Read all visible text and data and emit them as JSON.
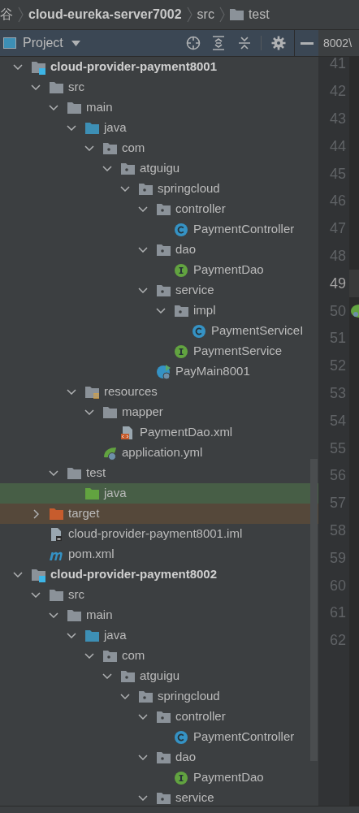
{
  "breadcrumb": [
    {
      "label": "谷",
      "kind": "text",
      "bold": false
    },
    {
      "label": "cloud-eureka-server7002",
      "kind": "text",
      "bold": true
    },
    {
      "label": "src",
      "kind": "text",
      "bold": false
    },
    {
      "label": "test",
      "kind": "folder",
      "bold": false
    }
  ],
  "project_panel": {
    "title": "Project",
    "tree": [
      {
        "label": "cloud-provider-payment8001",
        "kind": "module",
        "expanded": true,
        "selected": false,
        "children": [
          {
            "label": "src",
            "kind": "folder",
            "expanded": true,
            "selected": false,
            "children": [
              {
                "label": "main",
                "kind": "folder",
                "expanded": true,
                "selected": false,
                "children": [
                  {
                    "label": "java",
                    "kind": "source-folder",
                    "expanded": true,
                    "selected": false,
                    "children": [
                      {
                        "label": "com",
                        "kind": "package",
                        "expanded": true,
                        "selected": false,
                        "children": [
                          {
                            "label": "atguigu",
                            "kind": "package",
                            "expanded": true,
                            "selected": false,
                            "children": [
                              {
                                "label": "springcloud",
                                "kind": "package",
                                "expanded": true,
                                "selected": false,
                                "children": [
                                  {
                                    "label": "controller",
                                    "kind": "package",
                                    "expanded": true,
                                    "selected": false,
                                    "children": [
                                      {
                                        "label": "PaymentController",
                                        "kind": "class",
                                        "selected": false
                                      }
                                    ]
                                  },
                                  {
                                    "label": "dao",
                                    "kind": "package",
                                    "expanded": true,
                                    "selected": false,
                                    "children": [
                                      {
                                        "label": "PaymentDao",
                                        "kind": "interface",
                                        "selected": false
                                      }
                                    ]
                                  },
                                  {
                                    "label": "service",
                                    "kind": "package",
                                    "expanded": true,
                                    "selected": false,
                                    "children": [
                                      {
                                        "label": "impl",
                                        "kind": "package",
                                        "expanded": true,
                                        "selected": false,
                                        "children": [
                                          {
                                            "label": "PaymentServiceI",
                                            "kind": "class",
                                            "selected": false
                                          }
                                        ]
                                      },
                                      {
                                        "label": "PaymentService",
                                        "kind": "interface",
                                        "selected": false
                                      }
                                    ]
                                  },
                                  {
                                    "label": "PayMain8001",
                                    "kind": "boot-class",
                                    "selected": false
                                  }
                                ]
                              }
                            ]
                          }
                        ]
                      }
                    ]
                  },
                  {
                    "label": "resources",
                    "kind": "resources-folder",
                    "expanded": true,
                    "selected": false,
                    "children": [
                      {
                        "label": "mapper",
                        "kind": "folder",
                        "expanded": true,
                        "selected": false,
                        "children": [
                          {
                            "label": "PaymentDao.xml",
                            "kind": "xml",
                            "selected": false
                          }
                        ]
                      },
                      {
                        "label": "application.yml",
                        "kind": "yml",
                        "selected": false
                      }
                    ]
                  }
                ]
              },
              {
                "label": "test",
                "kind": "folder",
                "expanded": true,
                "selected": false,
                "children": [
                  {
                    "label": "java",
                    "kind": "test-folder",
                    "selected": true
                  }
                ]
              }
            ]
          },
          {
            "label": "target",
            "kind": "excluded-folder",
            "expanded": false,
            "selected": false
          },
          {
            "label": "cloud-provider-payment8001.iml",
            "kind": "iml",
            "selected": false
          },
          {
            "label": "pom.xml",
            "kind": "maven",
            "selected": false
          }
        ]
      },
      {
        "label": "cloud-provider-payment8002",
        "kind": "module",
        "expanded": true,
        "selected": false,
        "children": [
          {
            "label": "src",
            "kind": "folder",
            "expanded": true,
            "selected": false,
            "children": [
              {
                "label": "main",
                "kind": "folder",
                "expanded": true,
                "selected": false,
                "children": [
                  {
                    "label": "java",
                    "kind": "source-folder",
                    "expanded": true,
                    "selected": false,
                    "children": [
                      {
                        "label": "com",
                        "kind": "package",
                        "expanded": true,
                        "selected": false,
                        "children": [
                          {
                            "label": "atguigu",
                            "kind": "package",
                            "expanded": true,
                            "selected": false,
                            "children": [
                              {
                                "label": "springcloud",
                                "kind": "package",
                                "expanded": true,
                                "selected": false,
                                "children": [
                                  {
                                    "label": "controller",
                                    "kind": "package",
                                    "expanded": true,
                                    "selected": false,
                                    "children": [
                                      {
                                        "label": "PaymentController",
                                        "kind": "class",
                                        "selected": false
                                      }
                                    ]
                                  },
                                  {
                                    "label": "dao",
                                    "kind": "package",
                                    "expanded": true,
                                    "selected": false,
                                    "children": [
                                      {
                                        "label": "PaymentDao",
                                        "kind": "interface",
                                        "selected": false
                                      }
                                    ]
                                  },
                                  {
                                    "label": "service",
                                    "kind": "package",
                                    "expanded": true,
                                    "selected": false
                                  }
                                ]
                              }
                            ]
                          }
                        ]
                      }
                    ]
                  }
                ]
              }
            ]
          }
        ]
      }
    ]
  },
  "editor": {
    "tab_path": "8002\\",
    "lines": [
      {
        "number": "41",
        "current": false,
        "marker": false
      },
      {
        "number": "42",
        "current": false,
        "marker": false
      },
      {
        "number": "43",
        "current": false,
        "marker": false
      },
      {
        "number": "44",
        "current": false,
        "marker": false
      },
      {
        "number": "45",
        "current": false,
        "marker": false
      },
      {
        "number": "46",
        "current": false,
        "marker": false
      },
      {
        "number": "47",
        "current": false,
        "marker": false
      },
      {
        "number": "48",
        "current": false,
        "marker": false
      },
      {
        "number": "49",
        "current": true,
        "marker": false
      },
      {
        "number": "50",
        "current": false,
        "marker": true
      },
      {
        "number": "51",
        "current": false,
        "marker": false
      },
      {
        "number": "52",
        "current": false,
        "marker": false
      },
      {
        "number": "53",
        "current": false,
        "marker": false
      },
      {
        "number": "54",
        "current": false,
        "marker": false
      },
      {
        "number": "55",
        "current": false,
        "marker": false
      },
      {
        "number": "56",
        "current": false,
        "marker": false
      },
      {
        "number": "57",
        "current": false,
        "marker": false
      },
      {
        "number": "58",
        "current": false,
        "marker": false
      },
      {
        "number": "59",
        "current": false,
        "marker": false
      },
      {
        "number": "60",
        "current": false,
        "marker": false
      },
      {
        "number": "61",
        "current": false,
        "marker": false
      },
      {
        "number": "62",
        "current": false,
        "marker": false
      }
    ]
  }
}
